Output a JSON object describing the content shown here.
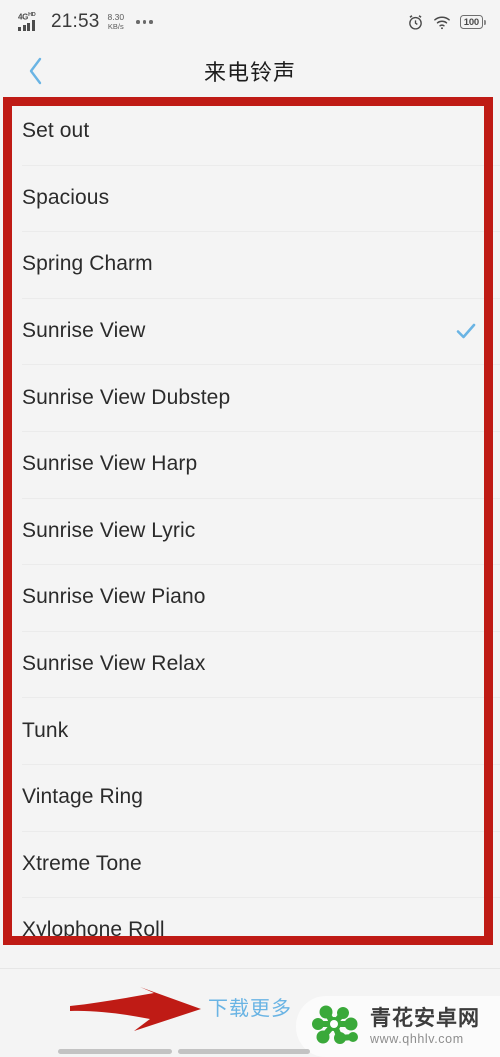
{
  "status_bar": {
    "network_type": "4G",
    "network_suffix": "HD",
    "signal_icon": "signal-bars-icon",
    "time": "21:53",
    "net_speed_value": "8.30",
    "net_speed_unit": "KB/s",
    "overflow_icon": "more-dots-icon",
    "alarm_icon": "alarm-clock-icon",
    "wifi_icon": "wifi-icon",
    "battery_level": "100",
    "battery_icon": "battery-icon"
  },
  "title_bar": {
    "back_icon": "back-chevron-icon",
    "title": "来电铃声"
  },
  "list": {
    "items": [
      {
        "label": "Set out",
        "selected": false
      },
      {
        "label": "Spacious",
        "selected": false
      },
      {
        "label": "Spring Charm",
        "selected": false
      },
      {
        "label": "Sunrise View",
        "selected": true
      },
      {
        "label": "Sunrise View Dubstep",
        "selected": false
      },
      {
        "label": "Sunrise View Harp",
        "selected": false
      },
      {
        "label": "Sunrise View Lyric",
        "selected": false
      },
      {
        "label": "Sunrise View Piano",
        "selected": false
      },
      {
        "label": "Sunrise View Relax",
        "selected": false
      },
      {
        "label": "Tunk",
        "selected": false
      },
      {
        "label": "Vintage Ring",
        "selected": false
      },
      {
        "label": "Xtreme Tone",
        "selected": false
      },
      {
        "label": "Xylophone Roll",
        "selected": false
      }
    ],
    "check_icon": "checkmark-icon"
  },
  "footer": {
    "download_more_label": "下载更多"
  },
  "annotations": {
    "box_icon": "red-highlight-box",
    "arrow_icon": "red-arrow-icon"
  },
  "watermark": {
    "logo_icon": "qinghua-android-logo-icon",
    "site_name": "青花安卓网",
    "site_url": "www.qhhlv.com"
  },
  "nav_bar": {
    "left_pill": "nav-pill-left",
    "right_pill": "nav-pill-right"
  },
  "colors": {
    "accent_blue": "#6ab4e4",
    "annotation_red": "#bf1b15",
    "background": "#f4f4f4",
    "logo_green": "#3aa93a"
  }
}
